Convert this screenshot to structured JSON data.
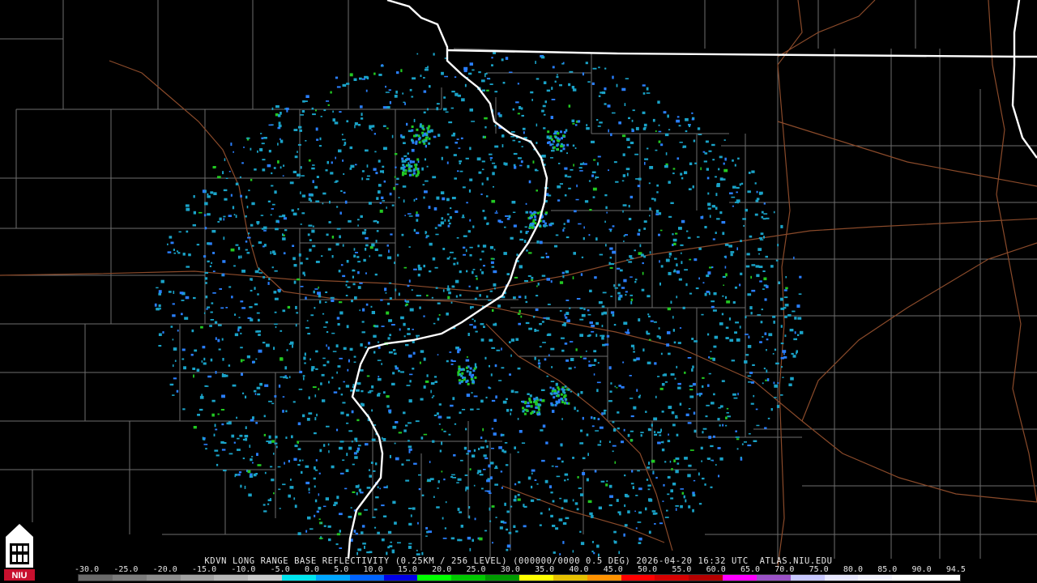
{
  "header": {
    "title": "KDVN LONG RANGE BASE REFLECTIVITY (0.25KM / 256 LEVEL) (000000/0000 0.5 DEG) 2026-04-20 16:32 UTC  ATLAS.NIU.EDU"
  },
  "scale": {
    "labels": [
      "-30.0",
      "-25.0",
      "-20.0",
      "-15.0",
      "-10.0",
      "-5.0",
      "0.0",
      "5.0",
      "10.0",
      "15.0",
      "20.0",
      "25.0",
      "30.0",
      "35.0",
      "40.0",
      "45.0",
      "50.0",
      "55.0",
      "60.0",
      "65.0",
      "70.0",
      "75.0",
      "80.0",
      "85.0",
      "90.0",
      "94.5"
    ],
    "colors": [
      "#6a6a6a",
      "#7c7c7c",
      "#8e8e8e",
      "#a2a2a2",
      "#b6b6b6",
      "#cacaca",
      "#00e5ee",
      "#00a6ff",
      "#0064ff",
      "#0000e6",
      "#00ff00",
      "#00c800",
      "#009a00",
      "#ffff00",
      "#e6c000",
      "#ff9200",
      "#ff0000",
      "#d60000",
      "#b40000",
      "#ff00ff",
      "#9a52c6",
      "#c8c8ff",
      "#e8e8ff",
      "#f4f4ff",
      "#ffffff",
      "#ffffff"
    ]
  },
  "logo": {
    "text": "NIU"
  },
  "map": {
    "radar_site": "KDVN",
    "colors": {
      "county_lines": "#6e6e6e",
      "state_lines": "#ffffff",
      "highways": "#8a4a2a",
      "echo_light": "#1aa3c8",
      "echo_mid": "#2a7fff",
      "echo_green": "#22c822"
    }
  }
}
